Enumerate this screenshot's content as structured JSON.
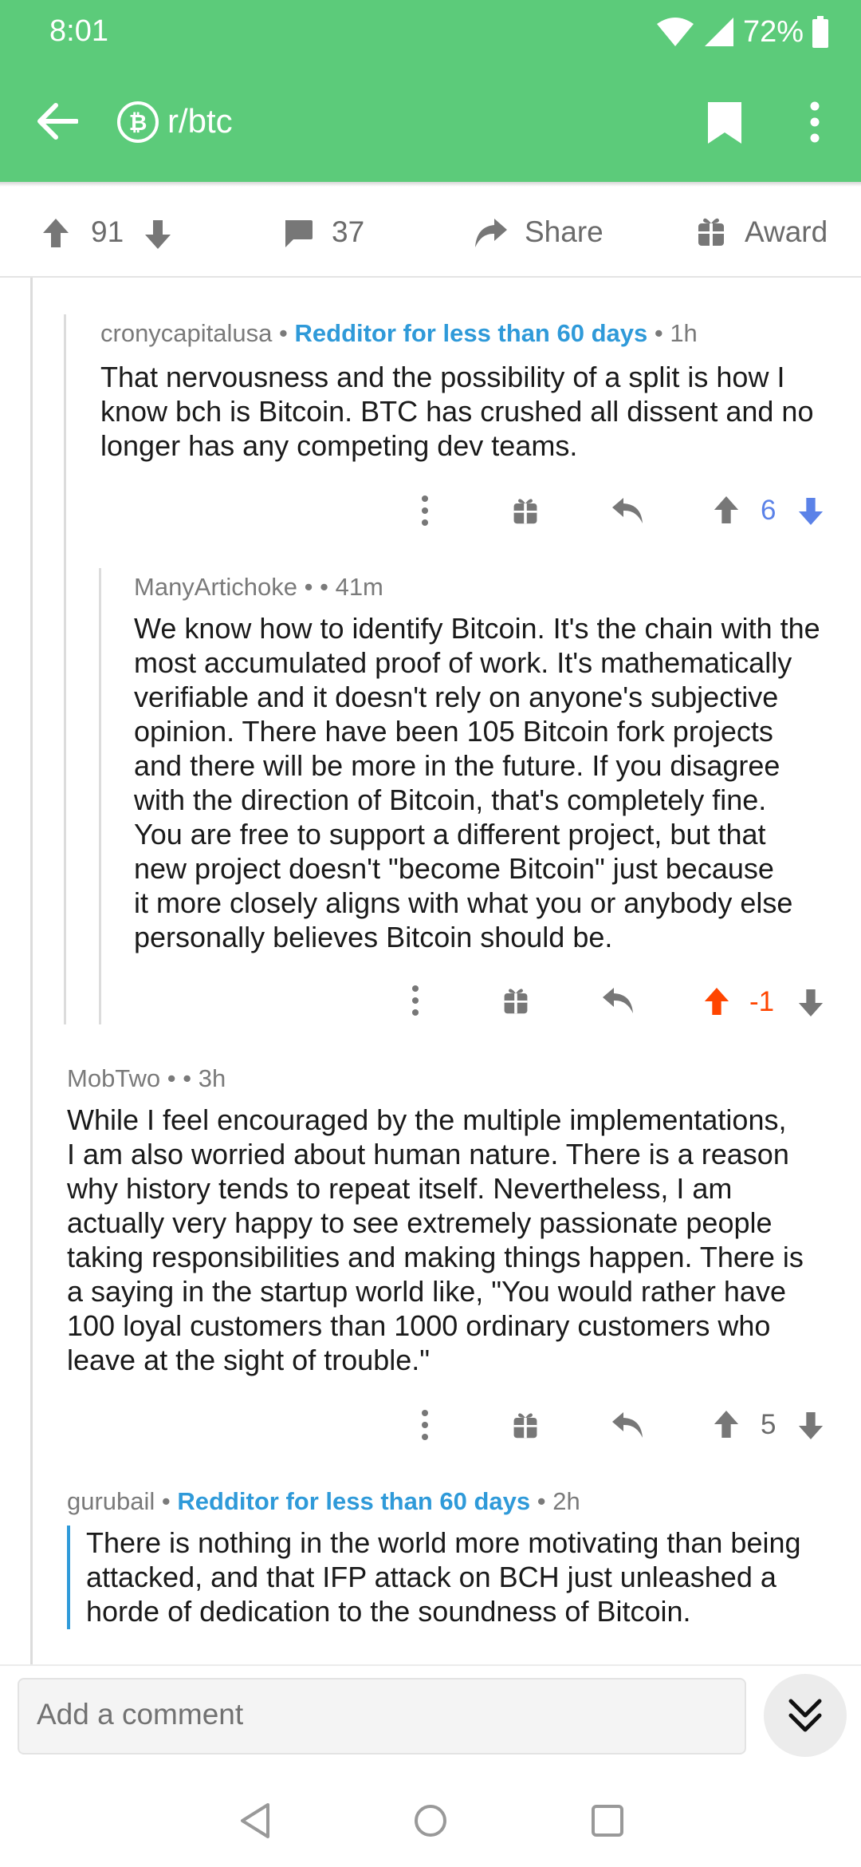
{
  "status": {
    "time": "8:01",
    "battery": "72%"
  },
  "header": {
    "subreddit": "r/btc",
    "colors": {
      "bar": "#5ccb7a"
    }
  },
  "actions": {
    "upvotes": "91",
    "comments": "37",
    "share": "Share",
    "award": "Award"
  },
  "comments": [
    {
      "author": "cronycapitalusa",
      "sep1": " • ",
      "flair": "Redditor for less than 60 days",
      "age": " • 1h",
      "lines": [
        "That nervousness and the possibility of a split is how I",
        "know bch is Bitcoin. BTC has crushed all dissent and no",
        "longer has any competing dev teams."
      ],
      "score": "6",
      "vote_state": "up-blue"
    },
    {
      "author": "ManyArtichoke",
      "age": " •  • 41m",
      "lines": [
        "We know how to identify Bitcoin. It's the chain with the",
        "most accumulated proof of work. It's mathematically",
        "verifiable and it doesn't rely on anyone's subjective",
        "opinion. There have been 105 Bitcoin fork projects",
        "and there will be more in the future. If you disagree",
        "with the direction of Bitcoin, that's completely fine.",
        "You are free to support a different project, but that",
        "new project doesn't \"become Bitcoin\" just because",
        "it more closely aligns with what you or anybody else",
        "personally believes Bitcoin should be."
      ],
      "score": "-1",
      "vote_state": "upvoted-orange"
    },
    {
      "author": "MobTwo",
      "age": " •  • 3h",
      "lines": [
        "While I feel encouraged by the multiple implementations,",
        "I am also worried about human nature. There is a reason",
        "why history tends to repeat itself. Nevertheless, I am",
        "actually very happy to see extremely passionate people",
        "taking responsibilities and making things happen. There is",
        "a saying in the startup world like, \"You would rather have",
        "100 loyal customers than 1000 ordinary customers who",
        "leave at the sight of trouble.\""
      ],
      "score": "5",
      "vote_state": "neutral"
    },
    {
      "author": "gurubail",
      "sep1": " • ",
      "flair": "Redditor for less than 60 days",
      "age": " • 2h",
      "lines": [
        "There is nothing in the world more motivating than being",
        "attacked, and that IFP attack on BCH just unleashed a",
        "horde of dedication to the soundness of Bitcoin."
      ]
    }
  ],
  "compose": {
    "placeholder": "Add a comment"
  },
  "icons": [
    "back-arrow-icon",
    "bitcoin-icon",
    "bookmark-icon",
    "more-vert-icon",
    "upvote-icon",
    "downvote-icon",
    "comment-icon",
    "share-icon",
    "award-icon",
    "reply-icon",
    "chevrons-down-icon"
  ],
  "colors": {
    "accent_blue": "#2f9ad9",
    "vote_blue": "#5b82e8",
    "vote_orange": "#ff4500",
    "icon_grey": "#777777"
  }
}
